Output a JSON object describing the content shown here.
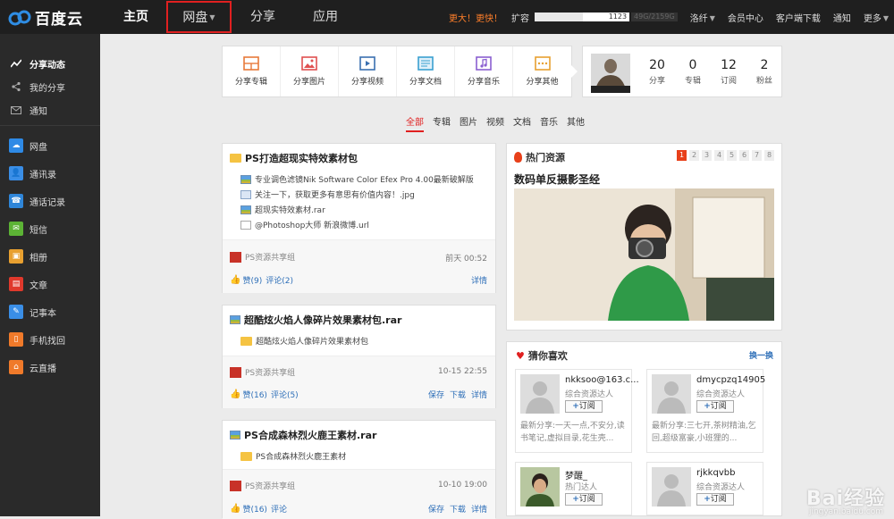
{
  "app": {
    "logo_text": "百度云"
  },
  "nav": {
    "items": [
      "主页",
      "网盘",
      "分享",
      "应用"
    ],
    "active": "网盘"
  },
  "topright": {
    "promo": "更大！更快！",
    "expand": "扩容",
    "quota_used": "1123",
    "quota_total": "49G/2159G",
    "quota_fraction": 0.51,
    "user": "洛纤",
    "member": "会员中心",
    "download": "客户端下载",
    "notify": "通知",
    "more": "更多"
  },
  "sidebar": {
    "items": [
      {
        "label": "分享动态",
        "icon": "trend-icon",
        "active": true
      },
      {
        "label": "我的分享",
        "icon": "share-icon"
      },
      {
        "label": "通知",
        "icon": "mail-icon"
      },
      {
        "label": "网盘",
        "icon": "cloud-icon",
        "color": "#2e8ae6"
      },
      {
        "label": "通讯录",
        "icon": "contacts-icon",
        "color": "#3a8ee6"
      },
      {
        "label": "通话记录",
        "icon": "call-log-icon",
        "color": "#2f86d9"
      },
      {
        "label": "短信",
        "icon": "sms-icon",
        "color": "#5cb335"
      },
      {
        "label": "相册",
        "icon": "photo-icon",
        "color": "#e8a030"
      },
      {
        "label": "文章",
        "icon": "article-icon",
        "color": "#e0392c"
      },
      {
        "label": "记事本",
        "icon": "notebook-icon",
        "color": "#3a8ee6"
      },
      {
        "label": "手机找回",
        "icon": "phone-find-icon",
        "color": "#f07a2a"
      },
      {
        "label": "云直播",
        "icon": "live-icon",
        "color": "#f07a2a"
      }
    ]
  },
  "share_bar": {
    "buttons": [
      {
        "label": "分享专辑",
        "icon": "album-icon",
        "color": "#e8793a"
      },
      {
        "label": "分享图片",
        "icon": "image-icon",
        "color": "#e05050"
      },
      {
        "label": "分享视频",
        "icon": "video-icon",
        "color": "#3a6fb0"
      },
      {
        "label": "分享文档",
        "icon": "document-icon",
        "color": "#3aa0d0"
      },
      {
        "label": "分享音乐",
        "icon": "music-icon",
        "color": "#8a5fd0"
      },
      {
        "label": "分享其他",
        "icon": "other-icon",
        "color": "#e8a030"
      }
    ]
  },
  "profile": {
    "stats": [
      {
        "num": "20",
        "label": "分享"
      },
      {
        "num": "0",
        "label": "专辑"
      },
      {
        "num": "12",
        "label": "订阅"
      },
      {
        "num": "2",
        "label": "粉丝"
      }
    ]
  },
  "filter": {
    "tabs": [
      "全部",
      "专辑",
      "图片",
      "视频",
      "文档",
      "音乐",
      "其他"
    ],
    "active": "全部"
  },
  "feed": [
    {
      "title": "PS打造超现实特效素材包",
      "files": [
        "专业调色滤镜Nik Software Color Efex Pro 4.00最新破解版",
        "关注一下，获取更多有意思有价值内容！.jpg",
        "超现实特效素材.rar",
        "@Photoshop大师 新浪微博.url"
      ],
      "group": "PS资源共享组",
      "time": "前天 00:52",
      "likes": "赞(9)",
      "comments": "评论(2)",
      "actions": [
        "详情"
      ]
    },
    {
      "title": "超酷炫火焰人像碎片效果素材包.rar",
      "files": [
        "超酷炫火焰人像碎片效果素材包"
      ],
      "group": "PS资源共享组",
      "time": "10-15 22:55",
      "likes": "赞(16)",
      "comments": "评论(5)",
      "actions": [
        "保存",
        "下载",
        "详情"
      ]
    },
    {
      "title": "PS合成森林烈火鹿王素材.rar",
      "files": [
        "PS合成森林烈火鹿王素材"
      ],
      "group": "PS资源共享组",
      "time": "10-10 19:00",
      "likes": "赞(16)",
      "comments": "评论",
      "actions": [
        "保存",
        "下载",
        "详情"
      ]
    }
  ],
  "hot": {
    "title": "热门资源",
    "pages": [
      "1",
      "2",
      "3",
      "4",
      "5",
      "6",
      "7",
      "8"
    ],
    "current_page": "1",
    "subtitle": "数码单反摄影圣经"
  },
  "guess": {
    "title": "猜你喜欢",
    "change": "换一换",
    "follow_label": "订阅",
    "follow_plus": "+",
    "users": [
      {
        "name": "nkksoo@163.c...",
        "role": "综合资源达人",
        "news": "最新分享:一天一点,不安分,读书笔记,虚拟目录,花生壳..."
      },
      {
        "name": "dmycpzq14905",
        "role": "综合资源达人",
        "news": "最新分享:三七开,茶树精油,乞回,超级富豪,小班狸的..."
      },
      {
        "name": "梦醒_",
        "role": "热门达人",
        "news": ""
      },
      {
        "name": "rjkkqvbb",
        "role": "综合资源达人",
        "news": ""
      }
    ]
  },
  "watermark": {
    "text": "Bai经验",
    "url": "jingyan.baidu.com"
  }
}
